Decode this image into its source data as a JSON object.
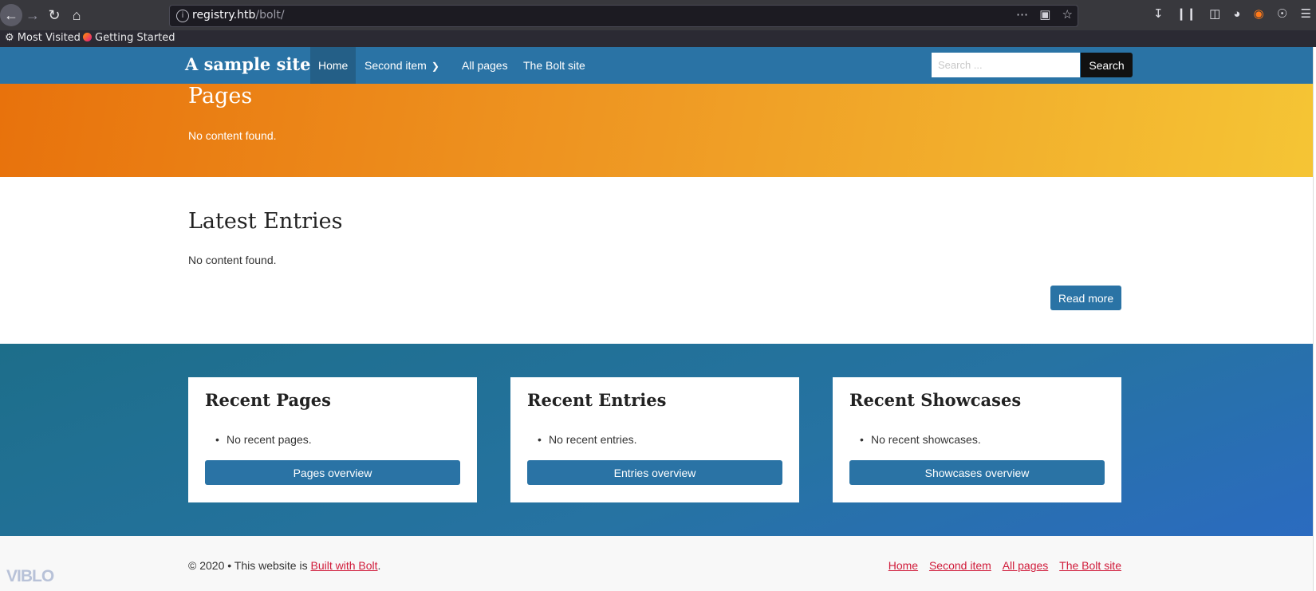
{
  "browser": {
    "url_host": "registry.htb",
    "url_path": "/bolt/",
    "bookmarks": [
      "Most Visited",
      "Getting Started"
    ],
    "icons": [
      "back-icon",
      "forward-icon",
      "reload-icon",
      "home-icon",
      "info-icon",
      "more-icon",
      "pocket-icon",
      "star-icon",
      "download-icon",
      "library-icon",
      "sidebar-icon",
      "shield-icon",
      "fox-icon",
      "account-icon",
      "menu-icon"
    ]
  },
  "site": {
    "brand": "A sample site",
    "nav": [
      "Home",
      "Second item",
      "All pages",
      "The Bolt site"
    ],
    "search_placeholder": "Search ...",
    "search_button": "Search"
  },
  "hero": {
    "title": "Pages",
    "text": "No content found."
  },
  "entries": {
    "title": "Latest Entries",
    "text": "No content found.",
    "read_more": "Read more"
  },
  "widgets": [
    {
      "title": "Recent Pages",
      "item": "No recent pages.",
      "button": "Pages overview"
    },
    {
      "title": "Recent Entries",
      "item": "No recent entries.",
      "button": "Entries overview"
    },
    {
      "title": "Recent Showcases",
      "item": "No recent showcases.",
      "button": "Showcases overview"
    }
  ],
  "footer": {
    "copy_prefix": "© 2020 • This website is ",
    "copy_link": "Built with Bolt",
    "copy_suffix": ".",
    "links": [
      "Home",
      "Second item",
      "All pages",
      "The Bolt site"
    ],
    "watermark": "VIBLO"
  },
  "colors": {
    "nav_bg": "#2a73a5",
    "accent": "#2a73a5",
    "link": "#d01b3a"
  }
}
